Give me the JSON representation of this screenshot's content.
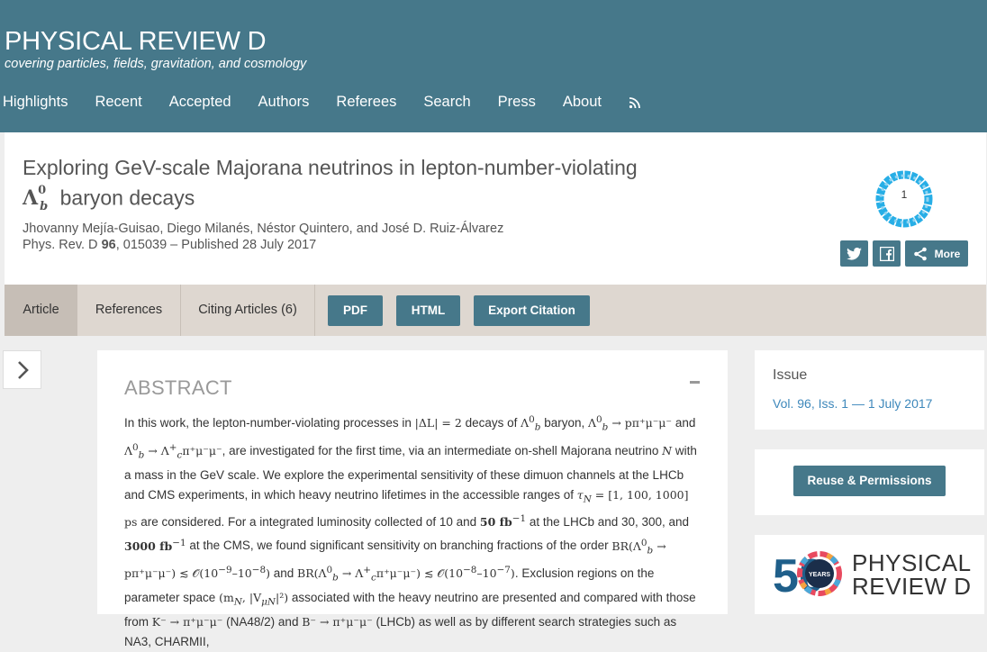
{
  "journal": {
    "title": "PHYSICAL REVIEW D",
    "subtitle": "covering particles, fields, gravitation, and cosmology"
  },
  "nav": [
    "Highlights",
    "Recent",
    "Accepted",
    "Authors",
    "Referees",
    "Search",
    "Press",
    "About"
  ],
  "nav_icon": "rss-icon",
  "article": {
    "title_line1": "Exploring GeV-scale Majorana neutrinos in lepton-number-violating",
    "title_symbol": "Λ",
    "title_symbol_sup": "0",
    "title_symbol_sub": "b",
    "title_line2_rest": "baryon decays",
    "authors": "Jhovanny Mejía-Guisao, Diego Milanés, Néstor Quintero, and José D. Ruiz-Álvarez",
    "citation_prefix": "Phys. Rev. D",
    "volume": "96",
    "citation_suffix": ", 015039 – Published 28 July 2017",
    "altmetric_score": "1"
  },
  "share": {
    "twitter_icon": "twitter-icon",
    "facebook_icon": "facebook-icon",
    "more_label": "More"
  },
  "tabs": [
    {
      "label": "Article",
      "active": true
    },
    {
      "label": "References",
      "active": false
    },
    {
      "label": "Citing Articles (6)",
      "active": false
    }
  ],
  "buttons": {
    "pdf": "PDF",
    "html": "HTML",
    "export": "Export Citation"
  },
  "abstract": {
    "heading": "ABSTRACT",
    "collapse": "-",
    "text": {
      "s01": "In this work, the lepton-number-violating processes in",
      "s02": "decays of",
      "s03": "baryon,",
      "s04": "and",
      "s05": ", are investigated for the first time, via an intermediate on-shell Majorana neutrino",
      "s06": "with a mass in the GeV scale. We explore the experimental sensitivity of these dimuon channels at the LHCb and CMS experiments, in which heavy neutrino lifetimes in the accessible ranges of",
      "s07": "ps",
      "s08": "are considered. For a integrated luminosity collected of 10 and",
      "s09": "at the LHCb and 30, 300, and",
      "s10": "at the CMS, we found significant sensitivity on branching fractions of the order",
      "s11": "and",
      "s12": ". Exclusion regions on the parameter space",
      "s13": "associated with the heavy neutrino are presented and compared with those from",
      "s14": "(NA48/2) and",
      "s15": "(LHCb) as well as by different search strategies such as NA3, CHARMII,"
    },
    "math": {
      "dl": "|ΔL| = 2",
      "lb": "Λ",
      "lb_sup": "0",
      "lb_sub": "b",
      "proc1": "→ pπ⁺μ⁻μ⁻",
      "proc2": "→ Λ",
      "proc2_sup": "+",
      "proc2_sub": "c",
      "proc2_tail": "π⁺μ⁻μ⁻",
      "n": "N",
      "tau": "τ",
      "tau_sub": "N",
      "tau_range": " = [1, 100, 1000]",
      "lumi1": "50 fb",
      "lumi2": "3000 fb",
      "inv": "−1",
      "br1": "BR(Λ",
      "br1_tail": "→ pπ⁺μ⁻μ⁻) ≲ 𝒪(10",
      "br1_exp1": "−9",
      "br1_mid": "–10",
      "br1_exp2": "−8",
      "br2": "BR(Λ",
      "br2_tail": "→ Λ",
      "br2_tail2": "π⁺μ⁻μ⁻) ≲ 𝒪(10",
      "br2_exp1": "−8",
      "br2_mid": "–10",
      "br2_exp2": "−7",
      "params": "(m",
      "params_sub": "N",
      "params_mid": ", |V",
      "params_sub2": "μN",
      "params_end": "|²)",
      "k": "K⁻ → π⁺μ⁻μ⁻",
      "b": "B⁻ → π⁺μ⁻μ⁻",
      "close": ")"
    }
  },
  "issue": {
    "heading": "Issue",
    "link": "Vol. 96, Iss. 1 — 1 July 2017"
  },
  "reuse_button": "Reuse & Permissions",
  "anniversary_logo": {
    "number": "50",
    "badge": "YEARS",
    "line1": "PHYSICAL",
    "line2": "REVIEW D"
  }
}
